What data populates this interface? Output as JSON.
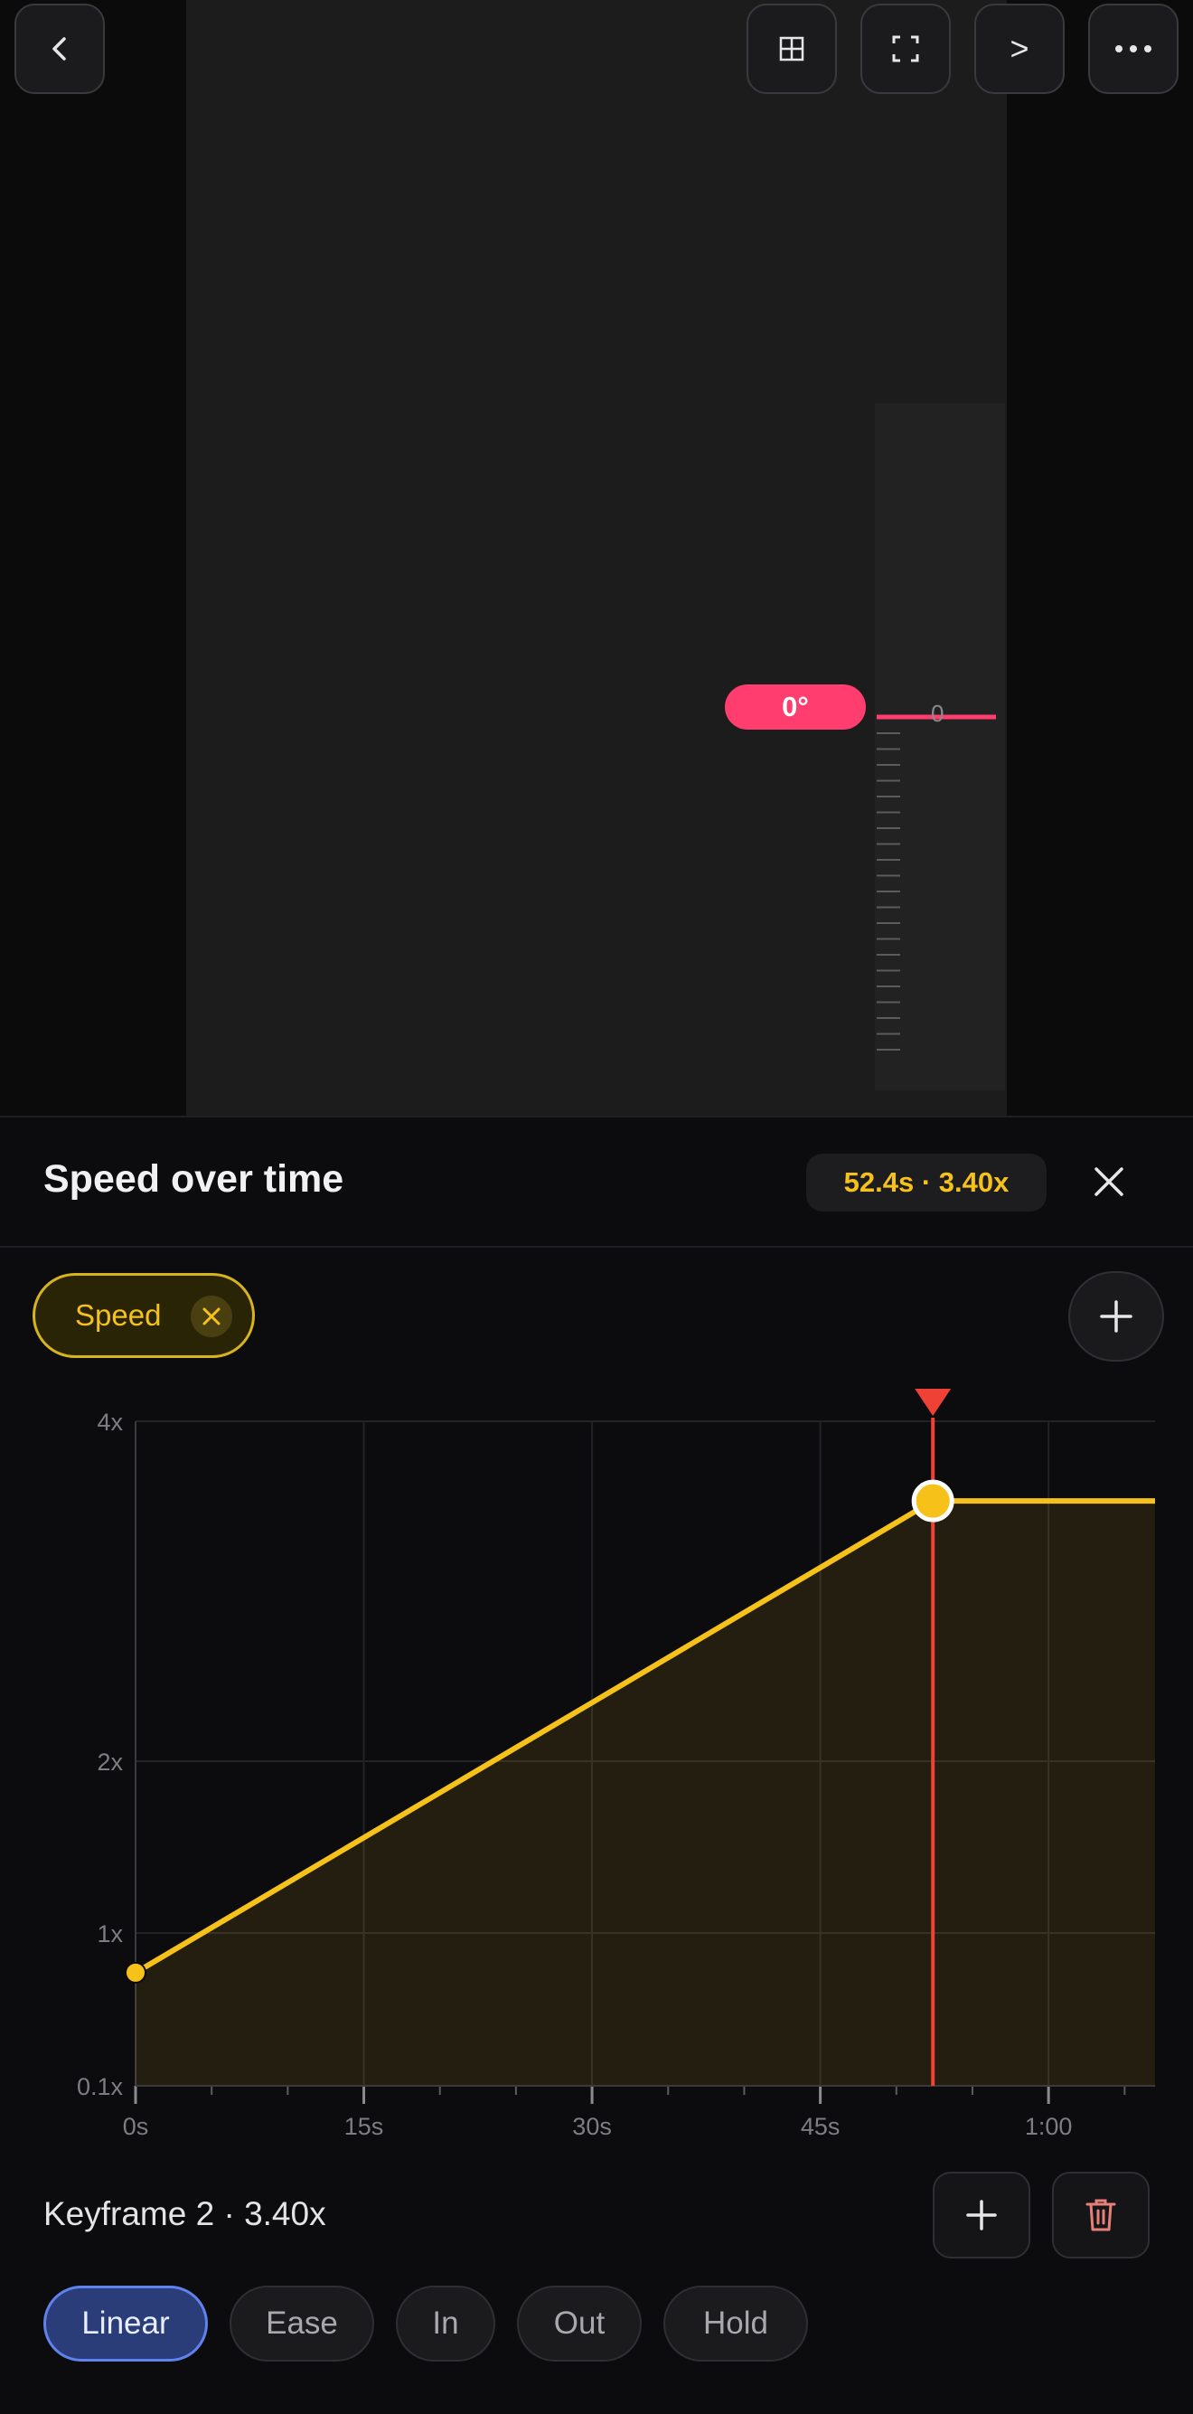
{
  "toolbar": {
    "back_icon": "chevron-left-icon",
    "grid_icon": "grid-icon",
    "fullscreen_icon": "fullscreen-icon",
    "next_label": ">",
    "more_icon": "more-icon"
  },
  "preview": {
    "angle_label": "0°",
    "ruler_zero": "0"
  },
  "panel": {
    "title": "Speed over time",
    "readout": "52.4s · 3.40x",
    "close_icon": "close-icon",
    "chip_label": "Speed",
    "add_track_icon": "plus-icon"
  },
  "keyframe": {
    "label": "Keyframe 2 · 3.40x",
    "add_icon": "plus-icon",
    "delete_icon": "trash-icon"
  },
  "easing": [
    {
      "label": "Linear",
      "active": true
    },
    {
      "label": "Ease",
      "active": false
    },
    {
      "label": "In",
      "active": false
    },
    {
      "label": "Out",
      "active": false
    },
    {
      "label": "Hold",
      "active": false
    }
  ],
  "colors": {
    "accent_yellow": "#f6c21a",
    "playhead_red": "#ef4136",
    "angle_pink": "#ff3d6e",
    "active_blue": "#2a3d78"
  },
  "chart_data": {
    "type": "line",
    "y_scale": "log",
    "x": [
      0,
      52.4,
      64
    ],
    "values": [
      0.55,
      3.4,
      3.4
    ],
    "x_ticks": [
      {
        "v": 0,
        "label": "0s"
      },
      {
        "v": 15,
        "label": "15s"
      },
      {
        "v": 30,
        "label": "30s"
      },
      {
        "v": 45,
        "label": "45s"
      },
      {
        "v": 60,
        "label": "1:00"
      }
    ],
    "y_ticks": [
      {
        "v": 4,
        "label": "4x"
      },
      {
        "v": 2,
        "label": "2x"
      },
      {
        "v": 1,
        "label": "1x"
      },
      {
        "v": 0.1,
        "label": "0.1x"
      }
    ],
    "xlim": [
      0,
      67
    ],
    "playhead": 52.4,
    "selected_keyframe": 1,
    "grid": true
  }
}
